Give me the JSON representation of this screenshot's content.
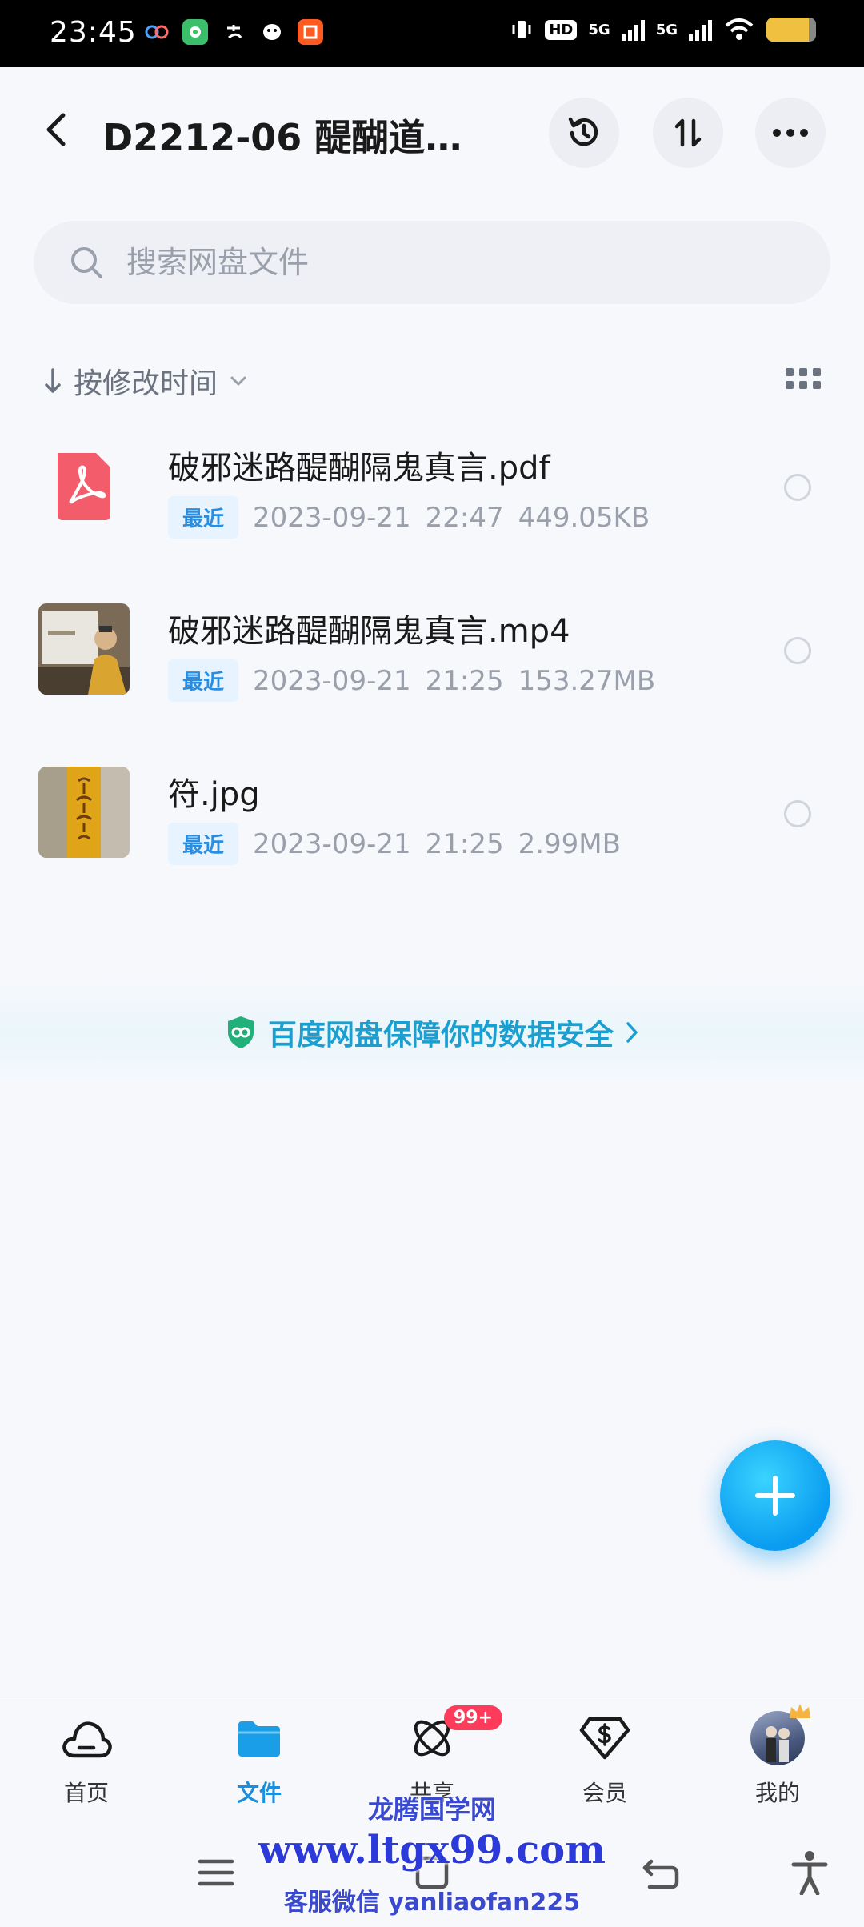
{
  "status_bar": {
    "time": "23:45",
    "hd_label": "HD",
    "net1": "5G",
    "net2": "5G",
    "battery_level": 0.85,
    "app_icons": [
      "baidu-netdisk-icon",
      "wechat-icon",
      "alipay-icon",
      "qq-icon",
      "taobao-icon"
    ]
  },
  "header": {
    "title": "D2212-06 醍醐道…"
  },
  "search": {
    "placeholder": "搜索网盘文件"
  },
  "sort": {
    "label": "按修改时间"
  },
  "files": [
    {
      "name": "破邪迷路醍醐隔鬼真言.pdf",
      "badge": "最近",
      "date": "2023-09-21",
      "time": "22:47",
      "size": "449.05KB",
      "type": "pdf"
    },
    {
      "name": "破邪迷路醍醐隔鬼真言.mp4",
      "badge": "最近",
      "date": "2023-09-21",
      "time": "21:25",
      "size": "153.27MB",
      "type": "video"
    },
    {
      "name": "符.jpg",
      "badge": "最近",
      "date": "2023-09-21",
      "time": "21:25",
      "size": "2.99MB",
      "type": "image"
    }
  ],
  "banner": {
    "text": "百度网盘保障你的数据安全"
  },
  "bottom_nav": {
    "items": [
      {
        "label": "首页",
        "icon": "cloud-icon"
      },
      {
        "label": "文件",
        "icon": "folder-icon",
        "active": true
      },
      {
        "label": "共享",
        "icon": "share-atom-icon",
        "badge": "99+"
      },
      {
        "label": "会员",
        "icon": "vip-diamond-icon"
      },
      {
        "label": "我的",
        "icon": "avatar"
      }
    ]
  },
  "watermark": {
    "line1": "龙腾国学网",
    "line2": "www.ltgx99.com",
    "line3": "客服微信 yanliaofan225"
  },
  "colors": {
    "accent": "#1a8fe0",
    "badge_bg": "#e7f4ff",
    "pdf_red": "#f25c6b",
    "nav_badge": "#ff3b5c"
  }
}
